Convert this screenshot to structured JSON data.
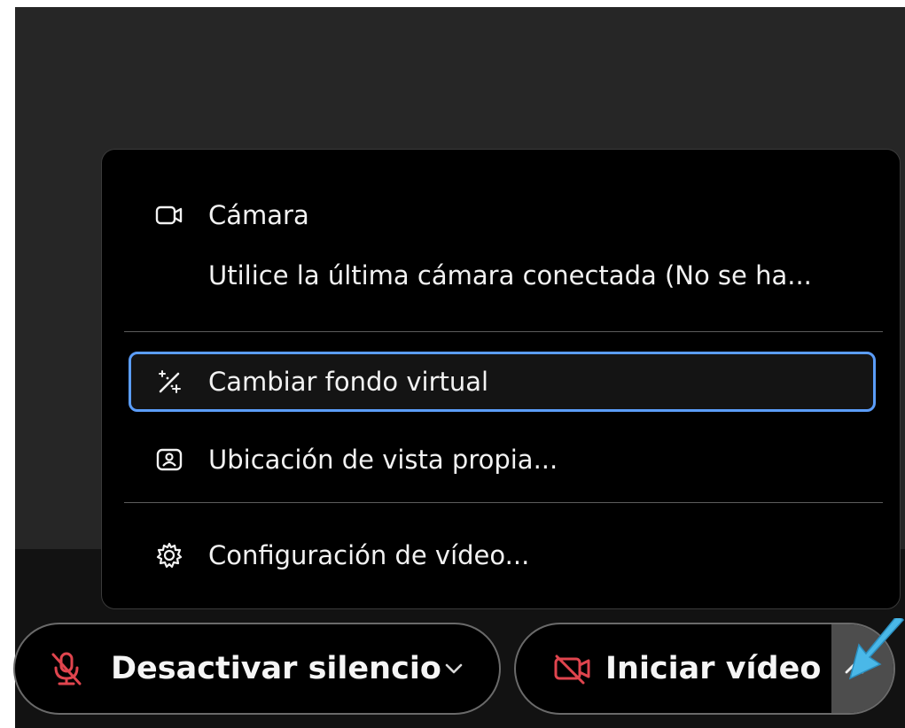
{
  "menu": {
    "camera_label": "Cámara",
    "camera_source": "Utilice la última cámara conectada (No se ha...",
    "virtual_background": "Cambiar fondo virtual",
    "self_view_location": "Ubicación de vista propia...",
    "video_settings": "Configuración de vídeo..."
  },
  "controls": {
    "mute_label": "Desactivar silencio",
    "video_label": "Iniciar vídeo"
  },
  "icons": {
    "camera": "video-camera-icon",
    "virtual_background": "magic-wand-icon",
    "self_view": "self-view-icon",
    "settings": "gear-icon",
    "mute": "microphone-muted-icon",
    "video_off": "video-off-icon",
    "mute_chevron": "chevron-down-icon",
    "video_chevron": "chevron-up-icon",
    "pointer": "blue-arrow-pointer-icon"
  },
  "colors": {
    "menu_background": "#000000",
    "focus_border": "#5b9dfa",
    "muted_red": "#e0454e",
    "pointer_blue": "#4ab8e8",
    "meeting_background": "#262626"
  }
}
